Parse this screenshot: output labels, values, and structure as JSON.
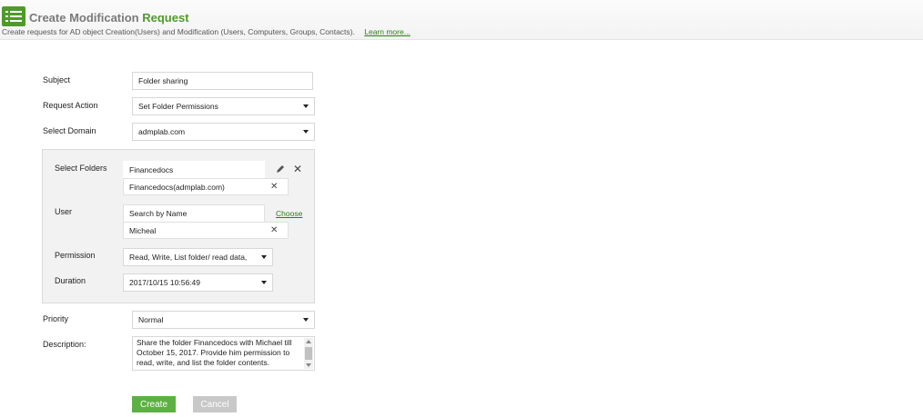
{
  "header": {
    "title_part1": "Create Modification",
    "title_part2": "Request",
    "subtitle": "Create requests for AD object Creation(Users) and Modification (Users, Computers, Groups, Contacts).",
    "learn_more": "Learn more..."
  },
  "form": {
    "subject_label": "Subject",
    "subject_value": "Folder sharing",
    "request_action_label": "Request Action",
    "request_action_value": "Set Folder Permissions",
    "domain_label": "Select Domain",
    "domain_value": "admplab.com",
    "folders_label": "Select Folders",
    "folder_input_value": "Financedocs",
    "folder_selected": "Financedocs(admplab.com)",
    "user_label": "User",
    "user_placeholder": "Search by Name",
    "choose_link": "Choose",
    "user_selected": "Micheal",
    "permission_label": "Permission",
    "permission_value": "Read, Write, List folder/ read data,",
    "duration_label": "Duration",
    "duration_value": "2017/10/15 10:56:49",
    "priority_label": "Priority",
    "priority_value": "Normal",
    "description_label": "Description:",
    "description_value": "Share the folder  Financedocs with Michael till October 15, 2017. Provide him permission to read, write, and list the folder contents."
  },
  "buttons": {
    "create": "Create",
    "cancel": "Cancel"
  },
  "icons": {
    "header": "list-icon",
    "edit": "pencil-icon",
    "remove": "close-icon"
  },
  "colors": {
    "accent": "#4f9a2a",
    "create_button": "#5db043",
    "cancel_button": "#c8c8c8",
    "link": "#2e7d16"
  }
}
